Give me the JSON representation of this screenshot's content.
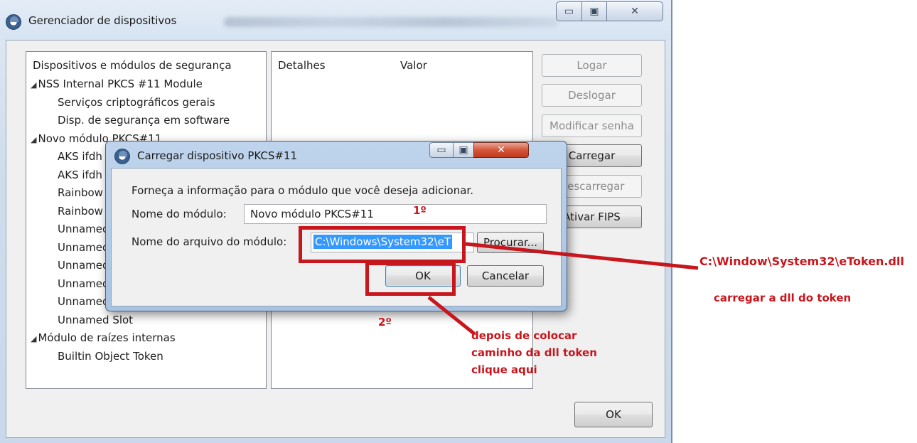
{
  "main_window": {
    "title": "Gerenciador de dispositivos",
    "controls": {
      "minimize": "▭",
      "maximize": "▣",
      "close": "✕"
    }
  },
  "device_list": {
    "header": "Dispositivos e módulos de segurança",
    "items": [
      {
        "label": "NSS Internal PKCS #11 Module",
        "level": 0,
        "expanded": true
      },
      {
        "label": "Serviços criptográficos gerais",
        "level": 1
      },
      {
        "label": "Disp. de segurança em software",
        "level": 1
      },
      {
        "label": "Novo módulo PKCS#11",
        "level": 0,
        "expanded": true
      },
      {
        "label": "AKS ifdh 0",
        "level": 1
      },
      {
        "label": "AKS ifdh 1",
        "level": 1
      },
      {
        "label": "Rainbow",
        "level": 1
      },
      {
        "label": "Rainbow",
        "level": 1
      },
      {
        "label": "Unnamed Slot",
        "level": 1
      },
      {
        "label": "Unnamed Slot",
        "level": 1
      },
      {
        "label": "Unnamed Slot",
        "level": 1
      },
      {
        "label": "Unnamed Slot",
        "level": 1
      },
      {
        "label": "Unnamed Slot",
        "level": 1
      },
      {
        "label": "Unnamed Slot",
        "level": 1
      },
      {
        "label": "Módulo de raízes internas",
        "level": 0,
        "expanded": true
      },
      {
        "label": "Builtin Object Token",
        "level": 1
      }
    ]
  },
  "details": {
    "col_detalhes": "Detalhes",
    "col_valor": "Valor"
  },
  "actions": {
    "logar": "Logar",
    "deslogar": "Deslogar",
    "modificar": "Modificar senha",
    "carregar": "Carregar",
    "descarregar": "Descarregar",
    "fips": "Ativar FIPS",
    "ok": "OK"
  },
  "dialog": {
    "title": "Carregar dispositivo PKCS#11",
    "info": "Forneça a informação para o módulo que você deseja adicionar.",
    "module_name_label": "Nome do módulo:",
    "module_name_value": "Novo módulo PKCS#11",
    "file_label": "Nome do arquivo do módulo:",
    "file_value": "C:\\Windows\\System32\\eT",
    "browse": "Procurar...",
    "ok": "OK",
    "cancel": "Cancelar"
  },
  "annotations": {
    "step1": "1º",
    "step2": "2º",
    "note_line1": "depois de colocar",
    "note_line2": "caminho da dll token",
    "note_line3": "clique aqui",
    "path": "C:\\Window\\System32\\eToken.dll",
    "load": "carregar a dll do token",
    "color": "#c8161d"
  }
}
